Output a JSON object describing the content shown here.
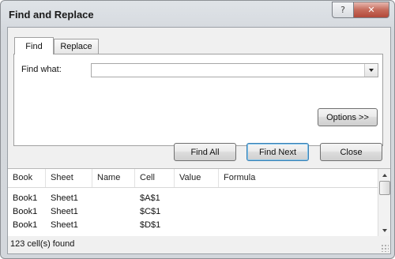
{
  "window": {
    "title": "Find and Replace",
    "help_glyph": "?",
    "close_glyph": "✕"
  },
  "tabs": [
    {
      "label": "Find",
      "active": true
    },
    {
      "label": "Replace",
      "active": false
    }
  ],
  "find": {
    "label": "Find what:",
    "value": ""
  },
  "buttons": {
    "options": "Options >>",
    "find_all": "Find All",
    "find_next": "Find Next",
    "close": "Close"
  },
  "results": {
    "columns": [
      "Book",
      "Sheet",
      "Name",
      "Cell",
      "Value",
      "Formula"
    ],
    "rows": [
      {
        "book": "Book1",
        "sheet": "Sheet1",
        "name": "",
        "cell": "$A$1",
        "value": "",
        "formula": ""
      },
      {
        "book": "Book1",
        "sheet": "Sheet1",
        "name": "",
        "cell": "$C$1",
        "value": "",
        "formula": ""
      },
      {
        "book": "Book1",
        "sheet": "Sheet1",
        "name": "",
        "cell": "$D$1",
        "value": "",
        "formula": ""
      }
    ]
  },
  "status": {
    "text": "123 cell(s) found"
  },
  "colors": {
    "close_button": "#c66b5b",
    "default_button_border": "#3c7fb1"
  }
}
